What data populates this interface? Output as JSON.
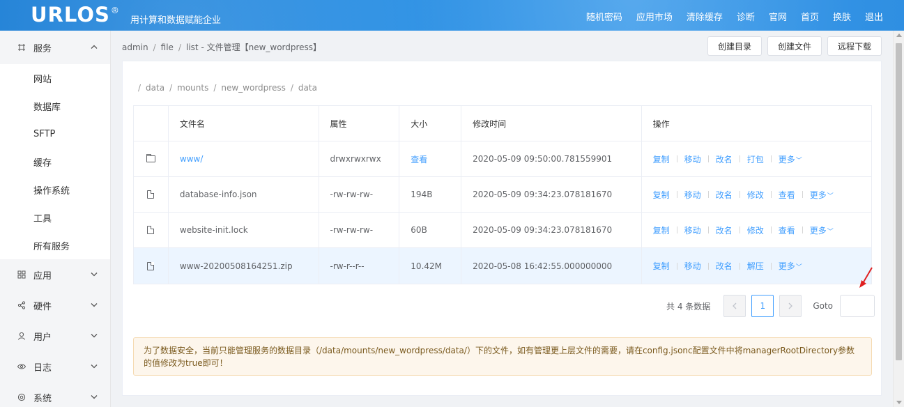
{
  "header": {
    "logo": "URLOS",
    "logo_mark": "®",
    "tagline": "用计算和数据赋能企业",
    "nav": [
      "随机密码",
      "应用市场",
      "清除缓存",
      "诊断",
      "官网",
      "首页",
      "换肤",
      "退出"
    ]
  },
  "sidebar": {
    "service_group": "服务",
    "service_items": [
      "网站",
      "数据库",
      "SFTP",
      "缓存",
      "操作系统",
      "工具",
      "所有服务"
    ],
    "groups": [
      {
        "label": "应用",
        "icon": "grid-icon"
      },
      {
        "label": "硬件",
        "icon": "share-icon"
      },
      {
        "label": "用户",
        "icon": "user-icon"
      },
      {
        "label": "日志",
        "icon": "eye-icon"
      },
      {
        "label": "系统",
        "icon": "settings-icon"
      }
    ]
  },
  "breadcrumb": {
    "admin": "admin",
    "file": "file",
    "list": "list",
    "title": "- 文件管理【new_wordpress】"
  },
  "actions": {
    "create_dir": "创建目录",
    "create_file": "创建文件",
    "remote_download": "远程下载"
  },
  "path": [
    "data",
    "mounts",
    "new_wordpress",
    "data"
  ],
  "table": {
    "headers": {
      "name": "文件名",
      "attr": "属性",
      "size": "大小",
      "mtime": "修改时间",
      "ops": "操作"
    },
    "rows": [
      {
        "name": "www/",
        "attr": "drwxrwxrwx",
        "size": "查看",
        "mtime": "2020-05-09 09:50:00.781559901",
        "ops": [
          "复制",
          "移动",
          "改名",
          "打包"
        ],
        "more": "更多",
        "type": "folder"
      },
      {
        "name": "database-info.json",
        "attr": "-rw-rw-rw-",
        "size": "194B",
        "mtime": "2020-05-09 09:34:23.078181670",
        "ops": [
          "复制",
          "移动",
          "改名",
          "修改",
          "查看"
        ],
        "more": "更多",
        "type": "file"
      },
      {
        "name": "website-init.lock",
        "attr": "-rw-rw-rw-",
        "size": "60B",
        "mtime": "2020-05-09 09:34:23.078181670",
        "ops": [
          "复制",
          "移动",
          "改名",
          "修改",
          "查看"
        ],
        "more": "更多",
        "type": "file"
      },
      {
        "name": "www-20200508164251.zip",
        "attr": "-rw-r--r--",
        "size": "10.42M",
        "mtime": "2020-05-08 16:42:55.000000000",
        "ops": [
          "复制",
          "移动",
          "改名",
          "解压"
        ],
        "more": "更多",
        "type": "file"
      }
    ]
  },
  "pagination": {
    "total": "共 4 条数据",
    "page": "1",
    "goto": "Goto"
  },
  "notice": "为了数据安全，当前只能管理服务的数据目录（/data/mounts/new_wordpress/data/）下的文件，如有管理更上层文件的需要，请在config.jsonc配置文件中将managerRootDirectory参数的值修改为true即可！",
  "colors": {
    "accent": "#409eff",
    "header": "#2b8fe3",
    "highlight_row": "#ecf5ff",
    "notice_bg": "#fdf6ec",
    "annotation": "#e02020"
  }
}
